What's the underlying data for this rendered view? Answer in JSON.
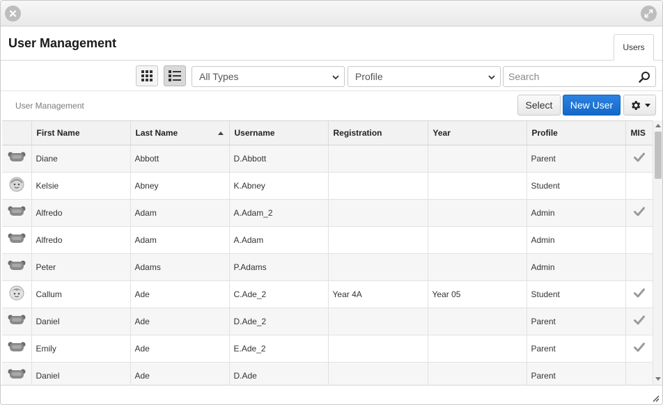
{
  "window": {
    "controls": [
      "close-icon",
      "expand-icon"
    ]
  },
  "header": {
    "title": "User Management",
    "tab_label": "Users"
  },
  "toolbar": {
    "view_modes": [
      "grid-view-icon",
      "list-view-icon"
    ],
    "active_view": "list",
    "type_filter": "All Types",
    "profile_filter": "Profile",
    "search_placeholder": "Search"
  },
  "actions": {
    "breadcrumb": "User Management",
    "select_label": "Select",
    "new_user_label": "New User",
    "settings_icon": "gear-icon"
  },
  "colors": {
    "primary_button": "#1a73d6",
    "row_alt": "#f6f6f6",
    "header_bg": "#f2f2f2"
  },
  "table": {
    "columns": [
      "",
      "First Name",
      "Last Name",
      "Username",
      "Registration",
      "Year",
      "Profile",
      "MIS"
    ],
    "sorted_column": "Last Name",
    "sort_direction": "ascending",
    "rows": [
      {
        "avatar": "adult",
        "first": "Diane",
        "last": "Abbott",
        "username": "D.Abbott",
        "registration": "",
        "year": "",
        "profile": "Parent",
        "mis": true
      },
      {
        "avatar": "student-girl",
        "first": "Kelsie",
        "last": "Abney",
        "username": "K.Abney",
        "registration": "",
        "year": "",
        "profile": "Student",
        "mis": false
      },
      {
        "avatar": "adult",
        "first": "Alfredo",
        "last": "Adam",
        "username": "A.Adam_2",
        "registration": "",
        "year": "",
        "profile": "Admin",
        "mis": true
      },
      {
        "avatar": "adult",
        "first": "Alfredo",
        "last": "Adam",
        "username": "A.Adam",
        "registration": "",
        "year": "",
        "profile": "Admin",
        "mis": false
      },
      {
        "avatar": "adult",
        "first": "Peter",
        "last": "Adams",
        "username": "P.Adams",
        "registration": "",
        "year": "",
        "profile": "Admin",
        "mis": false
      },
      {
        "avatar": "student-boy",
        "first": "Callum",
        "last": "Ade",
        "username": "C.Ade_2",
        "registration": "Year 4A",
        "year": "Year 05",
        "profile": "Student",
        "mis": true
      },
      {
        "avatar": "adult",
        "first": "Daniel",
        "last": "Ade",
        "username": "D.Ade_2",
        "registration": "",
        "year": "",
        "profile": "Parent",
        "mis": true
      },
      {
        "avatar": "adult",
        "first": "Emily",
        "last": "Ade",
        "username": "E.Ade_2",
        "registration": "",
        "year": "",
        "profile": "Parent",
        "mis": true
      },
      {
        "avatar": "adult",
        "first": "Daniel",
        "last": "Ade",
        "username": "D.Ade",
        "registration": "",
        "year": "",
        "profile": "Parent",
        "mis": false
      }
    ]
  }
}
